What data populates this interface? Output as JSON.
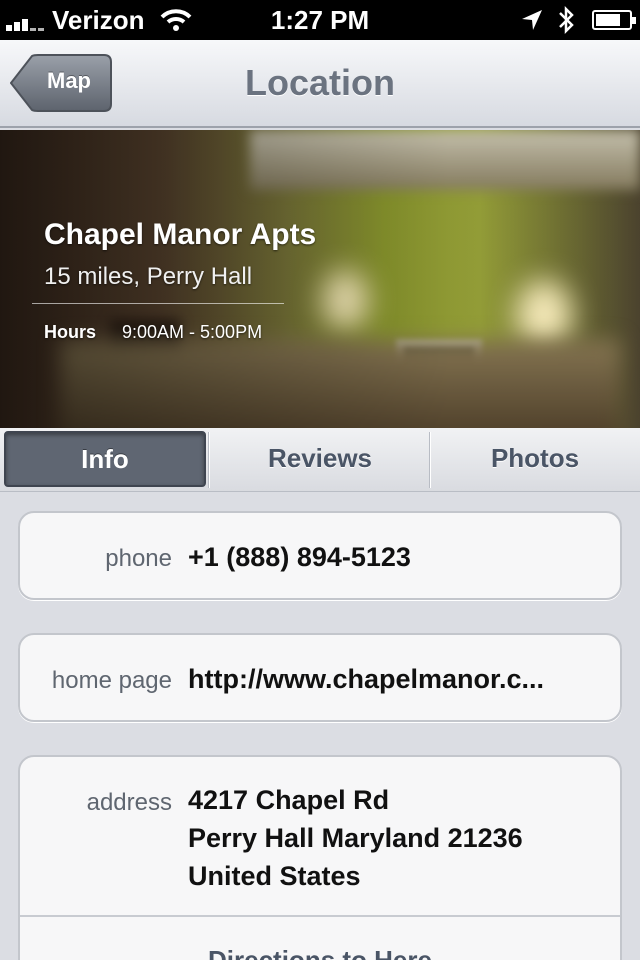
{
  "status_bar": {
    "carrier": "Verizon",
    "time": "1:27 PM"
  },
  "nav": {
    "back_label": "Map",
    "title": "Location"
  },
  "hero": {
    "title": "Chapel Manor Apts",
    "subtitle": "15 miles, Perry Hall",
    "hours_label": "Hours",
    "hours_value": "9:00AM - 5:00PM"
  },
  "tabs": [
    {
      "label": "Info",
      "active": true
    },
    {
      "label": "Reviews",
      "active": false
    },
    {
      "label": "Photos",
      "active": false
    }
  ],
  "info": {
    "phone": {
      "label": "phone",
      "value": "+1 (888) 894-5123"
    },
    "homepage": {
      "label": "home page",
      "value": "http://www.chapelmanor.c..."
    },
    "address": {
      "label": "address",
      "line1": "4217 Chapel Rd",
      "line2": "Perry Hall Maryland 21236",
      "line3": "United States"
    },
    "directions_label": "Directions to Here"
  },
  "colors": {
    "tab_active_bg": "#5f6672",
    "nav_title": "#6b7380",
    "background": "#dbdde3"
  },
  "icons": [
    "signal-icon",
    "wifi-icon",
    "location-arrow-icon",
    "bluetooth-icon",
    "battery-icon"
  ]
}
